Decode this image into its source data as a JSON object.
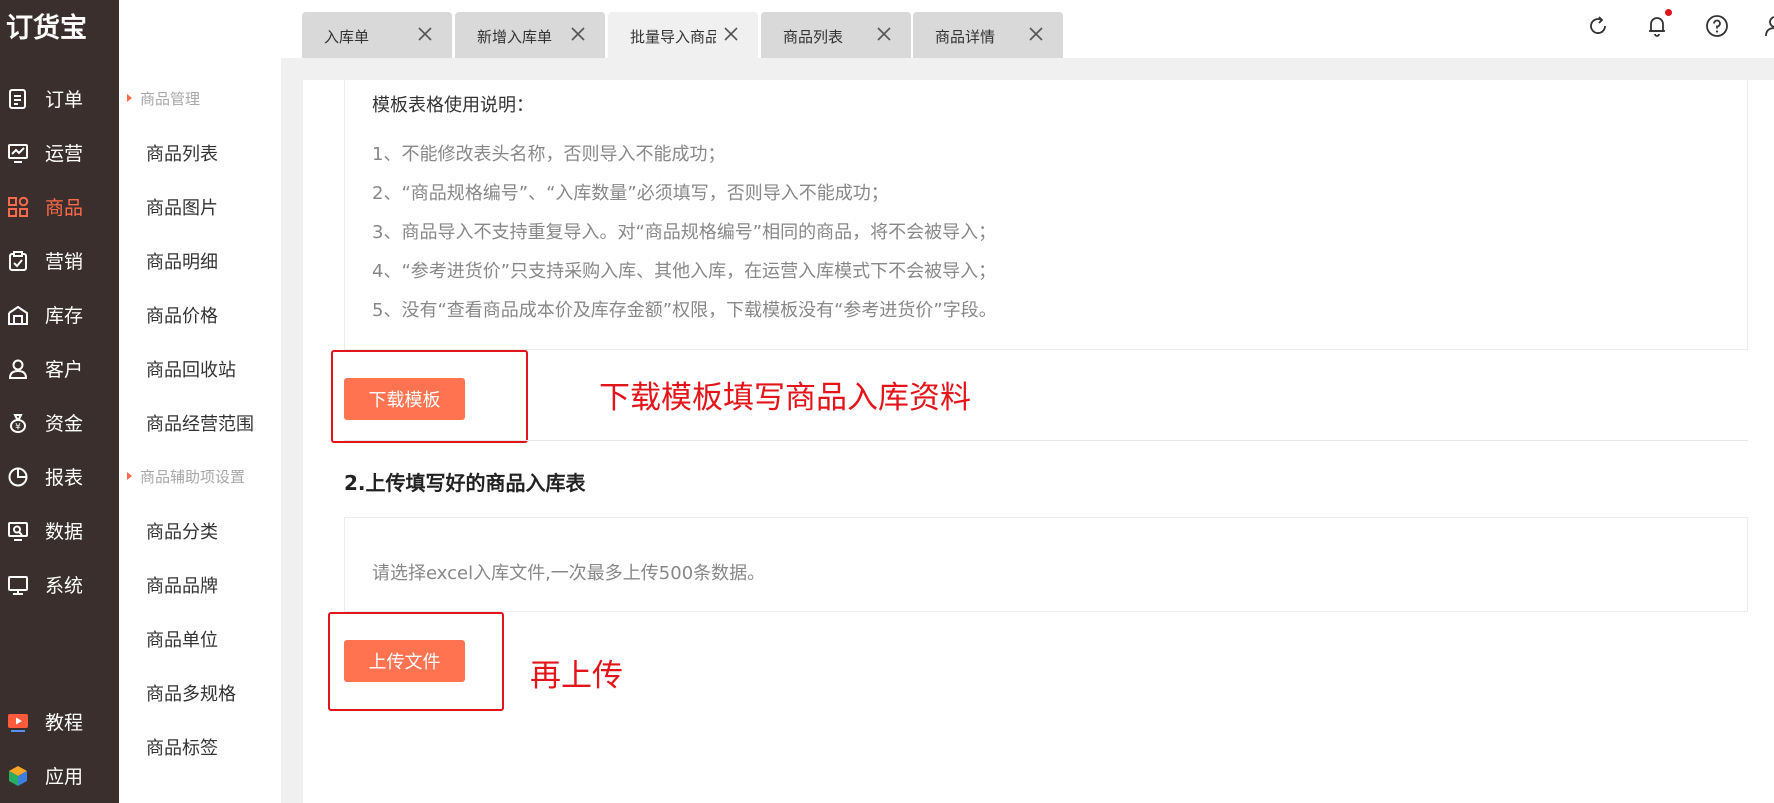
{
  "app": {
    "logo": "订货宝"
  },
  "sidebar": {
    "items": [
      {
        "label": "订单",
        "icon": "order-doc-icon"
      },
      {
        "label": "运营",
        "icon": "chart-screen-icon"
      },
      {
        "label": "商品",
        "icon": "grid-apps-icon",
        "active": true
      },
      {
        "label": "营销",
        "icon": "clipboard-check-icon"
      },
      {
        "label": "库存",
        "icon": "warehouse-icon"
      },
      {
        "label": "客户",
        "icon": "user-icon"
      },
      {
        "label": "资金",
        "icon": "money-bag-icon"
      },
      {
        "label": "报表",
        "icon": "pie-chart-icon"
      },
      {
        "label": "数据",
        "icon": "data-screen-icon"
      },
      {
        "label": "系统",
        "icon": "monitor-icon"
      },
      {
        "label": "教程",
        "icon": "video-tutorial-icon"
      },
      {
        "label": "应用",
        "icon": "cube-apps-icon"
      }
    ]
  },
  "subnav": {
    "group1": "商品管理",
    "group1_items": [
      "商品列表",
      "商品图片",
      "商品明细",
      "商品价格",
      "商品回收站",
      "商品经营范围"
    ],
    "group2": "商品辅助项设置",
    "group2_items": [
      "商品分类",
      "商品品牌",
      "商品单位",
      "商品多规格",
      "商品标签"
    ]
  },
  "tabs": [
    {
      "label": "入库单",
      "active": false
    },
    {
      "label": "新增入库单",
      "active": false
    },
    {
      "label": "批量导入商品",
      "active": true
    },
    {
      "label": "商品列表",
      "active": false
    },
    {
      "label": "商品详情",
      "active": false
    }
  ],
  "topbar": {
    "icons": [
      "refresh-icon",
      "bell-icon",
      "help-icon",
      "user-icon"
    ],
    "notification_dot_color": "#e3141a"
  },
  "instructions": {
    "title": "模板表格使用说明：",
    "lines": [
      "1、不能修改表头名称，否则导入不能成功；",
      "2、“商品规格编号”、“入库数量”必须填写，否则导入不能成功；",
      "3、商品导入不支持重复导入。对“商品规格编号”相同的商品，将不会被导入；",
      "4、“参考进货价”只支持采购入库、其他入库，在运营入库模式下不会被导入；",
      "5、没有“查看商品成本价及库存金额”权限，下载模板没有“参考进货价”字段。"
    ]
  },
  "download_button": "下载模板",
  "annotation_download": "下载模板填写商品入库资料",
  "section2_title": "2.上传填写好的商品入库表",
  "upload_hint": "请选择excel入库文件,一次最多上传500条数据。",
  "upload_button": "上传文件",
  "annotation_upload": "再上传",
  "colors": {
    "accent": "#ff6b4a",
    "button": "#ff7350",
    "sidebar_bg": "#3a2f2c",
    "annotation": "#e3141a"
  }
}
